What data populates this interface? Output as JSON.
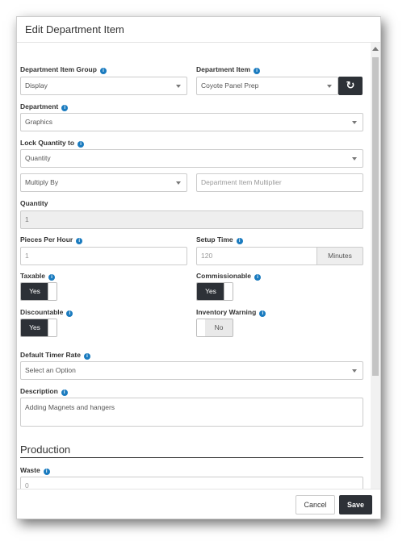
{
  "modal": {
    "title": "Edit Department Item"
  },
  "fields": {
    "department_item_group": {
      "label": "Department Item Group",
      "value": "Display"
    },
    "department_item": {
      "label": "Department Item",
      "value": "Coyote Panel Prep"
    },
    "department": {
      "label": "Department",
      "value": "Graphics"
    },
    "lock_quantity_to": {
      "label": "Lock Quantity to",
      "value": "Quantity"
    },
    "multiply_by": {
      "value": "Multiply By"
    },
    "multiplier": {
      "placeholder": "Department Item Multiplier"
    },
    "quantity": {
      "label": "Quantity",
      "value": "1"
    },
    "pieces_per_hour": {
      "label": "Pieces Per Hour",
      "placeholder": "1"
    },
    "setup_time": {
      "label": "Setup Time",
      "placeholder": "120",
      "unit": "Minutes"
    },
    "taxable": {
      "label": "Taxable",
      "state": "Yes"
    },
    "commissionable": {
      "label": "Commissionable",
      "state": "Yes"
    },
    "discountable": {
      "label": "Discountable",
      "state": "Yes"
    },
    "inventory_warning": {
      "label": "Inventory Warning",
      "state": "No"
    },
    "default_timer_rate": {
      "label": "Default Timer Rate",
      "value": "Select an Option"
    },
    "description": {
      "label": "Description",
      "value": "Adding Magnets and hangers"
    },
    "waste": {
      "label": "Waste",
      "placeholder": "0"
    }
  },
  "sections": {
    "production": "Production"
  },
  "footer": {
    "cancel_label": "Cancel",
    "save_label": "Save"
  },
  "icons": {
    "info": "info-icon",
    "refresh": "refresh-icon",
    "caret": "chevron-down-icon"
  },
  "colors": {
    "dark_button": "#2d3137",
    "info_blue": "#1a7bbf"
  }
}
